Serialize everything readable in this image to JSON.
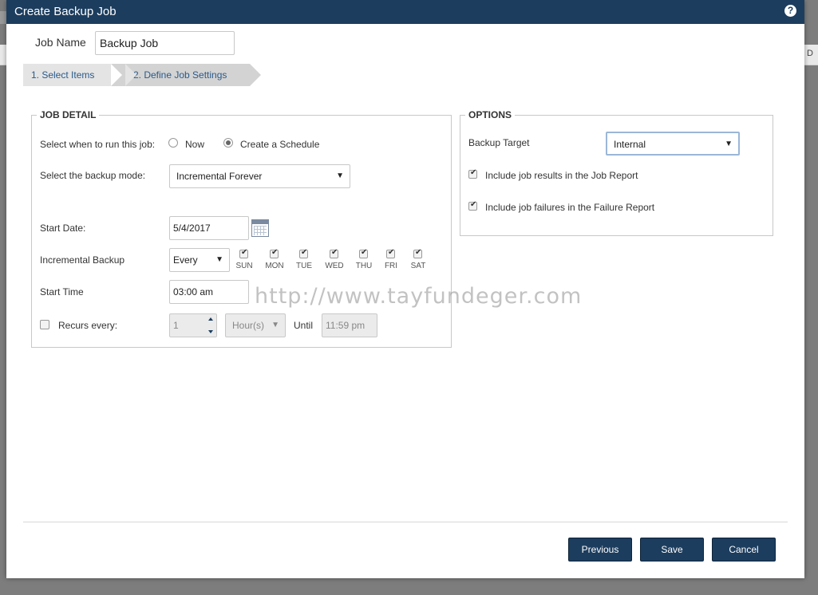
{
  "dialog": {
    "title": "Create Backup Job",
    "help_icon": "?"
  },
  "background": {
    "partial_text": "D"
  },
  "job_name": {
    "label": "Job Name",
    "value": "Backup Job"
  },
  "steps": [
    {
      "label": "1. Select Items"
    },
    {
      "label": "2. Define Job Settings"
    }
  ],
  "job_detail": {
    "legend": "JOB DETAIL",
    "run_label": "Select when to run this job:",
    "run_options": [
      {
        "label": "Now",
        "selected": false
      },
      {
        "label": "Create a Schedule",
        "selected": true
      }
    ],
    "mode_label": "Select the backup mode:",
    "mode_value": "Incremental Forever",
    "start_date_label": "Start Date:",
    "start_date_value": "5/4/2017",
    "incremental_label": "Incremental Backup",
    "incremental_value": "Every",
    "days": [
      {
        "label": "SUN",
        "checked": true
      },
      {
        "label": "MON",
        "checked": true
      },
      {
        "label": "TUE",
        "checked": true
      },
      {
        "label": "WED",
        "checked": true
      },
      {
        "label": "THU",
        "checked": true
      },
      {
        "label": "FRI",
        "checked": true
      },
      {
        "label": "SAT",
        "checked": true
      }
    ],
    "start_time_label": "Start Time",
    "start_time_value": "03:00 am",
    "recurs_label": "Recurs every:",
    "recurs_checked": false,
    "recurs_value": "1",
    "recurs_unit": "Hour(s)",
    "until_label": "Until",
    "until_value": "11:59 pm"
  },
  "options": {
    "legend": "OPTIONS",
    "target_label": "Backup Target",
    "target_value": "Internal",
    "include_job_report": {
      "label": "Include job results in the Job Report",
      "checked": true
    },
    "include_failure_report": {
      "label": "Include job failures in the Failure Report",
      "checked": true
    }
  },
  "watermark": "http://www.tayfundeger.com",
  "buttons": {
    "previous": "Previous",
    "save": "Save",
    "cancel": "Cancel"
  },
  "colors": {
    "titlebar": "#1c3d5e",
    "button": "#1c3d5e"
  }
}
